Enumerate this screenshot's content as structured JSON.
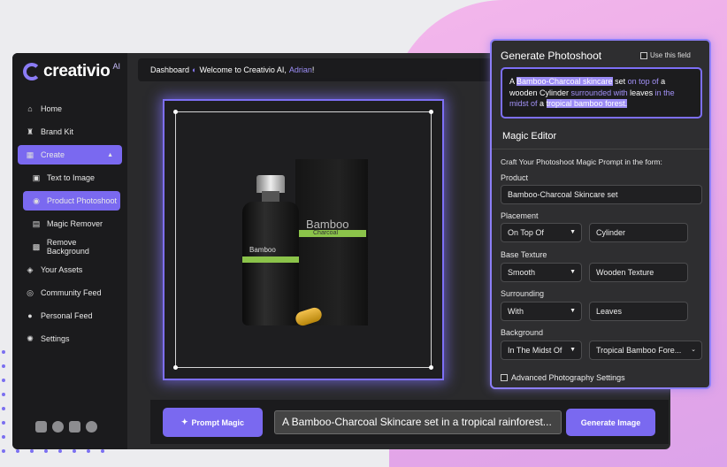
{
  "brand": {
    "name": "creativio",
    "sup": "AI"
  },
  "sidebar": {
    "items": [
      {
        "label": "Home",
        "icon": "home-icon"
      },
      {
        "label": "Brand Kit",
        "icon": "brand-kit-icon"
      },
      {
        "label": "Create",
        "icon": "grid-icon"
      },
      {
        "label": "Text to Image",
        "icon": "text-image-icon"
      },
      {
        "label": "Product Photoshoot",
        "icon": "camera-icon"
      },
      {
        "label": "Magic Remover",
        "icon": "magic-remover-icon"
      },
      {
        "label": "Remove Background",
        "icon": "remove-bg-icon"
      },
      {
        "label": "Your Assets",
        "icon": "assets-icon"
      },
      {
        "label": "Community Feed",
        "icon": "community-icon"
      },
      {
        "label": "Personal Feed",
        "icon": "person-icon"
      },
      {
        "label": "Settings",
        "icon": "gear-icon"
      }
    ],
    "socials": [
      "youtube-icon",
      "twitter-icon",
      "discord-icon",
      "facebook-icon"
    ]
  },
  "header": {
    "breadcrumb": "Dashboard",
    "welcome": "Welcome to Creativio AI,",
    "user": "Adrian",
    "suffix": "!"
  },
  "canvas": {
    "bottle_label": "Bamboo",
    "box_label": "Bamboo",
    "box_sub": "Charcoal"
  },
  "prompt": {
    "magic_button": "Prompt Magic",
    "input_value": "A Bamboo-Charcoal Skincare set in a tropical rainforest...",
    "generate_button": "Generate Image"
  },
  "panel": {
    "title": "Generate Photoshoot",
    "use_field": "Use this field",
    "summary": {
      "p1": "A ",
      "h1": "Bamboo-Charcoal skincare",
      "p2": " set ",
      "u1": "on top of",
      "p3": " a wooden Cylinder ",
      "u2": "surrounded with",
      "p4": " leaves ",
      "u3": "in the midst of",
      "p5": " a ",
      "h2": "tropical bamboo forest."
    },
    "magic_editor": "Magic Editor",
    "craft": "Craft Your Photoshoot Magic Prompt in the form:",
    "product_label": "Product",
    "product_value": "Bamboo-Charcoal Skincare set",
    "placement_label": "Placement",
    "placement_select": "On Top Of",
    "placement_value": "Cylinder",
    "base_label": "Base Texture",
    "base_select": "Smooth",
    "base_value": "Wooden Texture",
    "surround_label": "Surrounding",
    "surround_select": "With",
    "surround_value": "Leaves",
    "background_label": "Background",
    "background_select": "In The Midst Of",
    "background_value": "Tropical Bamboo Fore...",
    "advanced": "Advanced Photography Settings"
  },
  "colors": {
    "accent": "#7a69f0",
    "pink": "#e8a7e6",
    "sidebar": "#1b1b1d"
  }
}
